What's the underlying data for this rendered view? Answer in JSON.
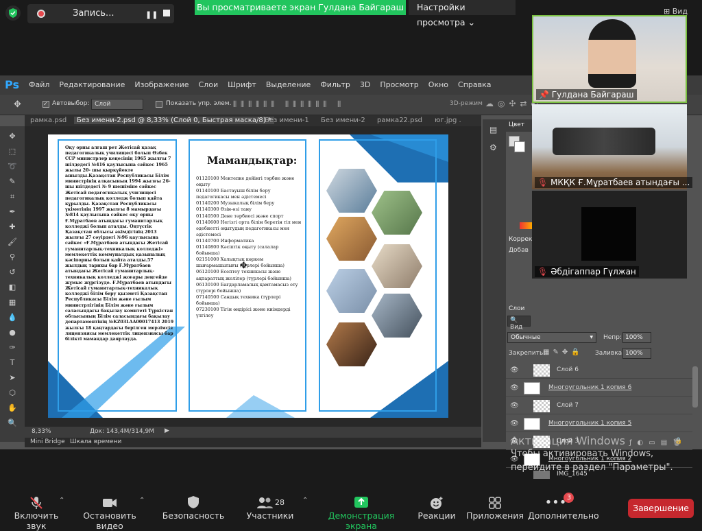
{
  "zoom": {
    "recording_label": "Запись...",
    "share_banner": "Вы просматриваете экран Гулдана Байгараш",
    "view_settings": "Настройки просмотра",
    "view_top": "Вид",
    "participants_videos": [
      {
        "name": "Гулдана Байгараш"
      },
      {
        "name": "МКҚК Ғ.Мұратбаев атындағы ..."
      },
      {
        "name": "Әбдігаппар Гүлжан"
      }
    ],
    "toolbar": [
      {
        "label": "Включить звук",
        "icon": "mic-muted-icon"
      },
      {
        "label": "Остановить видео",
        "icon": "video-icon"
      },
      {
        "label": "Безопасность",
        "icon": "shield-icon"
      },
      {
        "label": "Участники",
        "icon": "people-icon",
        "count": "28"
      },
      {
        "label": "Демонстрация экрана",
        "icon": "share-screen-icon"
      },
      {
        "label": "Реакции",
        "icon": "emoji-icon"
      },
      {
        "label": "Приложения",
        "icon": "apps-icon"
      },
      {
        "label": "Дополнительно",
        "icon": "more-icon",
        "badge": "3"
      }
    ],
    "end_button": "Завершение"
  },
  "photoshop": {
    "logo": "Ps",
    "menu": [
      "Файл",
      "Редактирование",
      "Изображение",
      "Слои",
      "Шрифт",
      "Выделение",
      "Фильтр",
      "3D",
      "Просмотр",
      "Окно",
      "Справка"
    ],
    "options": {
      "autoselect": "Автовыбор:",
      "layer": "Слой",
      "show_controls": "Показать упр. элем.",
      "mode3d": "3D-режим"
    },
    "tabs": [
      "рамка.psd",
      "Без имени-2.psd @ 8,33% (Слой 0, Быстрая маска/8) *",
      "Без имени-1",
      "Без имени-2",
      "рамка22.psd",
      "юг.jpg ."
    ],
    "status": {
      "zoom": "8,33%",
      "doc": "Док: 143,4M/314,9M"
    },
    "bottom_tabs": [
      "Mini Bridge",
      "Шкала времени"
    ],
    "panels": {
      "color_tab": "Цвет",
      "correction_tab": "Коррек",
      "add_label": "Добав",
      "layers_tab": "Слои",
      "kind": "Вид",
      "blend_mode": "Обычные",
      "opacity_label": "Непр:",
      "opacity_value": "100%",
      "lock_label": "Закрепить:",
      "fill_label": "Заливка:",
      "fill_value": "100%",
      "layers": [
        "Слой 6",
        "Многоугольник 1 копия 6",
        "Слой 7",
        "Многоугольник 1 копия 5",
        "Слой 3",
        "Многоугольник 1 копия 2",
        "IMG_1645"
      ]
    }
  },
  "document": {
    "history_text": "Оқу орны алғаш рет Жетісай қазақ педагогикалық училищесі болып Өзбек ССР министрлер кеңесінің 1965 жылғы 7 шілдедегі №416 қаулысына сәйкес 1965 жылы 20- шы қыркүйекте ашылды.Қазақстан Республикасы Білім министрінің алқасының 1994 жылғы 26-шы шілдедегі № 9 шешіміне сәйкес Жетісай педагогикалық училищесі педагогикалық колледж болып қайта құрылды. Қазақстан Республикасы үкіметінің 1997 жылғы 8 мамырдағы №814 қаулысына сәйкес оқу орны Ғ.Мұратбаев атындағы гуманитарлық колледжі болып аталды. Оңтүстік Қазақстан облысы әкімдігінің 2013 жылғы 27 сәуірдегі №96 қаулысына сәйкес «Ғ.Мұратбаев атындағы Жетісай гуманитарлық-техникалық колледжі» мемлекеттік коммуналдық қазыналық кәсіпорны болып қайта аталды.57 жылдық тарихы бар Ғ.Мұратбаев атындағы Жетісай гуманитарлық-техникалық колледжі жоғары деңгейде жұмыс жүргізуде. Ғ.Мұратбаев атындағы Жетісай гуманитарлық-техникалық колледжі білім беру қызметі Қазақстан Республикасы Білім және ғылым министрлігінің Білім және ғылым саласындағы бақылау комитеті Түркістан облысының Білім саласындағы бақылау департаментінің №KZ03LAA00017413 2019 жылғы 18 қаңтардағы берілген мерзімсіз лицензиясы мемлекеттік лицензиясы бар білікті мамандар даярлауда.",
    "spec_title": "Мамандықтар:",
    "spec_list": [
      "01120100 Мектепке дейінгі тәрбие және оқыту",
      "01140100 Бастауыш білім беру педагогикасы мен әдістемесі",
      "01140200 Музыкалық білім беру",
      "01140300 Өзін-өзі тану",
      "01140500 Дене тәрбиесі және спорт",
      "01140600 Негізгі орта білім беретін тіл мен әдебиетті оқытудың педагогикасы мен әдістемесі",
      "01140700 Информатика",
      "01140800 Кәсіптік оқыту (салалар бойынша)",
      "02151000 Халықтық көркем шығармашылығы (түрлері бойынша)",
      "06120100 Есептеу техникасы және ақпараттық желілер (түрлері бойынша)",
      "06130100 Бағдарламалық қамтамасыз ету (түрлері бойынша)",
      "07140500 Сандық техника (түрлері бойынша)",
      "07230100 Тігін өндірісі және киімдерді үлгілеу"
    ]
  },
  "windows": {
    "activation_title": "Активация Windows",
    "activation_body": "Чтобы активировать Windows, перейдите в раздел \"Параметры\"."
  },
  "colors": {
    "zoom_green": "#22c55e",
    "zoom_red": "#c6282e",
    "ps_blue": "#31a8ff",
    "brochure_blue": "#2f9ee8"
  }
}
